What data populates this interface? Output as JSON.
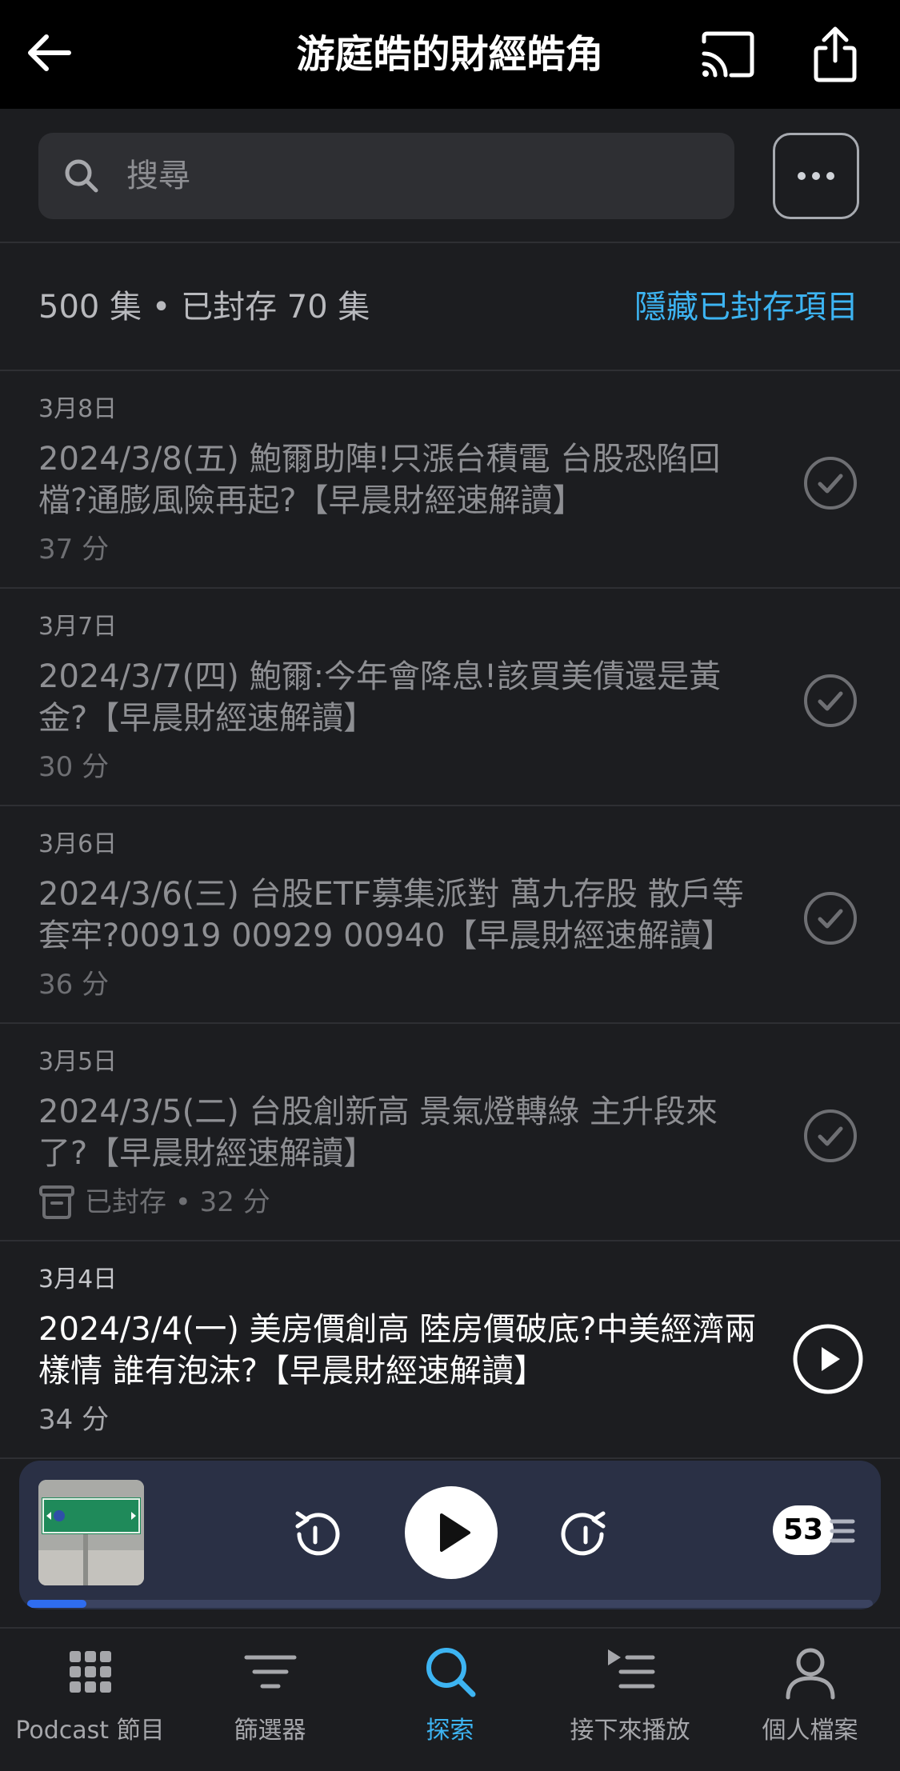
{
  "header": {
    "title": "游庭皓的財經皓角",
    "back_icon": "back-arrow-icon",
    "cast_icon": "cast-icon",
    "share_icon": "share-icon"
  },
  "search": {
    "placeholder": "搜尋",
    "icon": "search-icon",
    "more_icon": "more-options-icon"
  },
  "summary": {
    "count_text": "500 集 • 已封存 70 集",
    "hide_archived_label": "隱藏已封存項目"
  },
  "episodes": [
    {
      "date": "3月8日",
      "title": "2024/3/8(五) 鮑爾助陣!只漲台積電 台股恐陷回檔?通膨風險再起?【早晨財經速解讀】",
      "meta": "37 分",
      "archived": false,
      "status_icon": "played-check-icon"
    },
    {
      "date": "3月7日",
      "title": "2024/3/7(四) 鮑爾:今年會降息!該買美債還是黃金?【早晨財經速解讀】",
      "meta": "30 分",
      "archived": false,
      "status_icon": "played-check-icon"
    },
    {
      "date": "3月6日",
      "title": "2024/3/6(三) 台股ETF募集派對 萬九存股 散戶等套牢?00919 00929 00940【早晨財經速解讀】",
      "meta": "36 分",
      "archived": false,
      "status_icon": "played-check-icon"
    },
    {
      "date": "3月5日",
      "title": "2024/3/5(二) 台股創新高 景氣燈轉綠 主升段來了?【早晨財經速解讀】",
      "meta": "已封存 • 32 分",
      "archived": true,
      "status_icon": "played-check-icon"
    },
    {
      "date": "3月4日",
      "title": "2024/3/4(一) 美房價創高 陸房價破底?中美經濟兩樣情 誰有泡沫?【早晨財經速解讀】",
      "meta": "34 分",
      "archived": false,
      "status_icon": "play-circle-icon"
    }
  ],
  "mini_player": {
    "artwork_text": "重新路",
    "artwork_subtext": "一段",
    "artwork_small": "Chongxin Rd. Sec. 1",
    "rewind_icon": "rewind-icon",
    "play_icon": "play-icon",
    "forward_icon": "forward-icon",
    "queue_count": "53",
    "progress": 0.07
  },
  "tabs": [
    {
      "label": "Podcast 節目",
      "icon": "grid-icon",
      "active": false
    },
    {
      "label": "篩選器",
      "icon": "filter-icon",
      "active": false
    },
    {
      "label": "探索",
      "icon": "search-icon",
      "active": true
    },
    {
      "label": "接下來播放",
      "icon": "up-next-icon",
      "active": false
    },
    {
      "label": "個人檔案",
      "icon": "profile-icon",
      "active": false
    }
  ],
  "colors": {
    "accent": "#3db4f2",
    "background": "#1c1d20",
    "player_bg": "#2a3045",
    "progress": "#2f6df0"
  }
}
